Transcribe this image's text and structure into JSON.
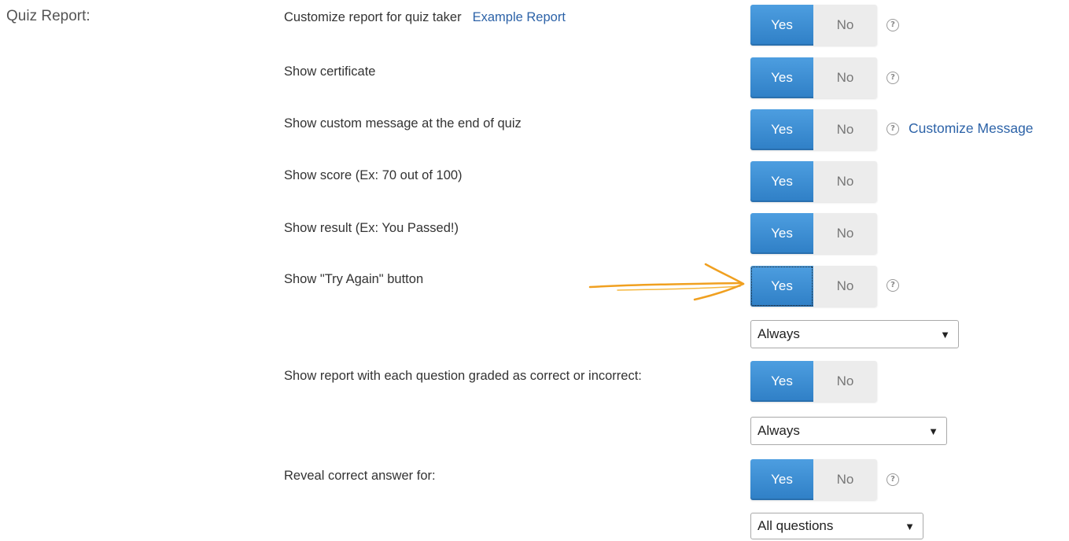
{
  "section": {
    "label": "Quiz Report:"
  },
  "options": [
    {
      "label": "Customize report for quiz taker",
      "link": "Example Report",
      "yes": "Yes",
      "no": "No",
      "help": "?"
    },
    {
      "label": "Show certificate",
      "yes": "Yes",
      "no": "No",
      "help": "?"
    },
    {
      "label": "Show custom message at the end of quiz",
      "yes": "Yes",
      "no": "No",
      "help": "?",
      "help_link": "Customize Message"
    },
    {
      "label": "Show score (Ex: 70 out of 100)",
      "yes": "Yes",
      "no": "No"
    },
    {
      "label": "Show result (Ex: You Passed!)",
      "yes": "Yes",
      "no": "No"
    },
    {
      "label": "Show \"Try Again\" button",
      "yes": "Yes",
      "no": "No",
      "help": "?",
      "select": {
        "value": "Always"
      }
    },
    {
      "label": "Show report with each question graded as correct or incorrect:",
      "yes": "Yes",
      "no": "No",
      "select": {
        "value": "Always"
      }
    },
    {
      "label": "Reveal correct answer for:",
      "yes": "Yes",
      "no": "No",
      "help": "?",
      "select": {
        "value": "All questions"
      }
    }
  ],
  "select_arrow": "▼",
  "colors": {
    "toggle_active": "#3a8bd2",
    "link": "#2d63a8",
    "annotation_arrow": "#f0a020"
  }
}
